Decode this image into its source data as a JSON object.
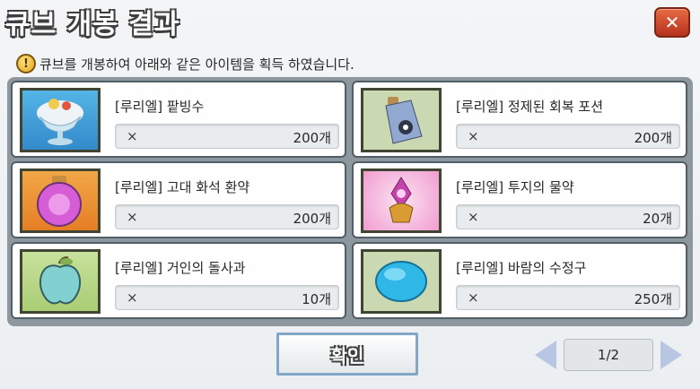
{
  "dialog": {
    "title": "큐브 개봉 결과",
    "close_label": "✕",
    "notice_icon": "!",
    "notice": "큐브를 개봉하여 아래와 같은 아이템을 획득 하였습니다."
  },
  "items": [
    {
      "name": "[루리엘] 팥빙수",
      "x": "×",
      "qty": "200개",
      "icon": "patbingsu-icon"
    },
    {
      "name": "[루리엘] 정제된 회복 포션",
      "x": "×",
      "qty": "200개",
      "icon": "potion-icon"
    },
    {
      "name": "[루리엘] 고대 화석 환약",
      "x": "×",
      "qty": "200개",
      "icon": "fossil-pill-icon"
    },
    {
      "name": "[루리엘] 투지의 물약",
      "x": "×",
      "qty": "20개",
      "icon": "fighting-spirit-potion-icon"
    },
    {
      "name": "[루리엘] 거인의 돌사과",
      "x": "×",
      "qty": "10개",
      "icon": "stone-apple-icon"
    },
    {
      "name": "[루리엘] 바람의 수정구",
      "x": "×",
      "qty": "250개",
      "icon": "crystal-orb-icon"
    }
  ],
  "footer": {
    "confirm_label": "확인",
    "page": "1/2"
  },
  "background": {
    "slot_values": [
      "1000",
      "419",
      "1000"
    ]
  },
  "colors": {
    "close_button": "#c8401f",
    "confirm_border": "#7fa4c4",
    "panel": "#8a959c"
  }
}
